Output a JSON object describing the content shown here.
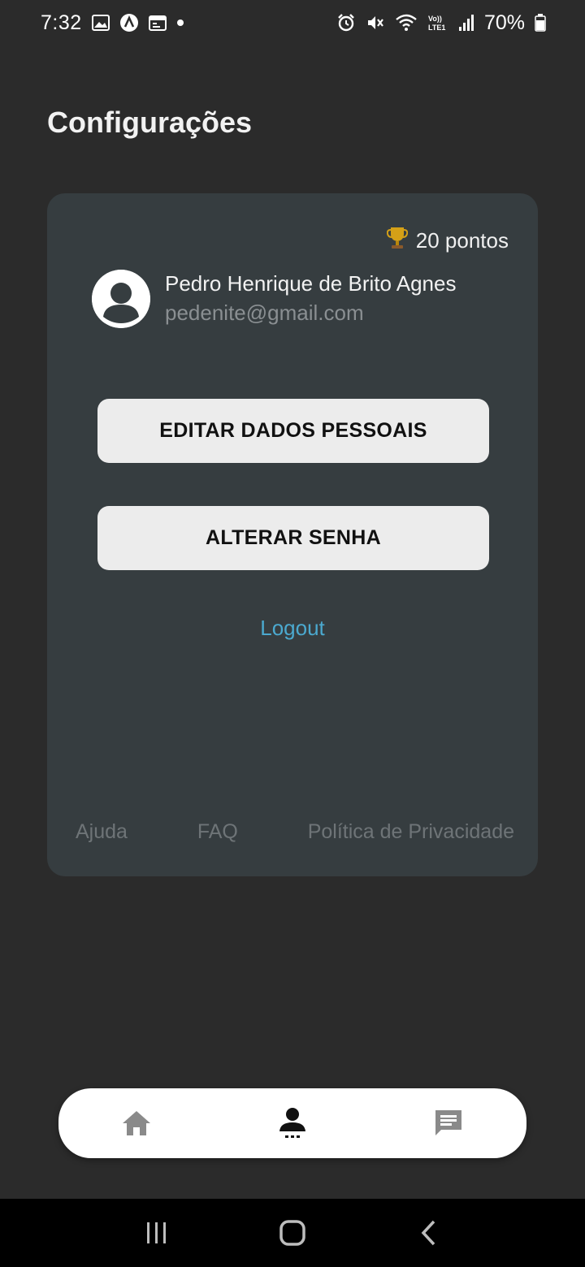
{
  "status_bar": {
    "time": "7:32",
    "battery": "70%",
    "icons": [
      "gallery-icon",
      "app-icon",
      "calendar-icon",
      "dot-icon",
      "alarm-icon",
      "mute-icon",
      "wifi-icon",
      "volte-icon",
      "signal-icon",
      "battery-icon"
    ]
  },
  "header": {
    "title": "Configurações"
  },
  "card": {
    "points": "20 pontos",
    "user": {
      "name": "Pedro Henrique de Brito Agnes",
      "email": "pedenite@gmail.com"
    },
    "buttons": {
      "edit_profile": "EDITAR DADOS PESSOAIS",
      "change_password": "ALTERAR SENHA"
    },
    "logout": "Logout",
    "footer_links": [
      "Ajuda",
      "FAQ",
      "Política de Privacidade"
    ]
  },
  "bottom_nav": {
    "items": [
      {
        "icon": "home-icon",
        "active": false
      },
      {
        "icon": "profile-icon",
        "active": true
      },
      {
        "icon": "chat-icon",
        "active": false
      }
    ]
  },
  "system_nav": {
    "items": [
      "recents-icon",
      "home-button-icon",
      "back-icon"
    ]
  },
  "colors": {
    "background": "#2b2b2b",
    "card": "#363d40",
    "button": "#ececec",
    "link": "#4ba9cf",
    "muted": "#6e7477"
  }
}
